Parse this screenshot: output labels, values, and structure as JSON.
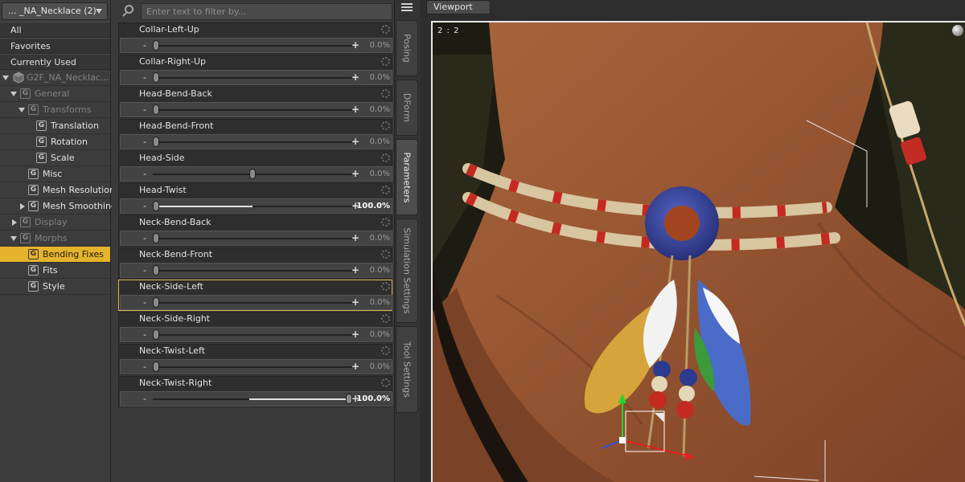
{
  "node_select": {
    "value": "... _NA_Necklace (2)"
  },
  "filters": [
    "All",
    "Favorites",
    "Currently Used"
  ],
  "tree": [
    {
      "label": "G2F_NA_Necklac...",
      "dim": true
    },
    {
      "label": "General",
      "dim": true
    },
    {
      "label": "Transforms",
      "dim": true
    },
    {
      "label": "Translation"
    },
    {
      "label": "Rotation"
    },
    {
      "label": "Scale"
    },
    {
      "label": "Misc"
    },
    {
      "label": "Mesh Resolution"
    },
    {
      "label": "Mesh Smoothing"
    },
    {
      "label": "Display",
      "dim": true
    },
    {
      "label": "Morphs",
      "dim": true
    },
    {
      "label": "Bending Fixes",
      "selected": true
    },
    {
      "label": "Fits"
    },
    {
      "label": "Style"
    }
  ],
  "params_filter": {
    "placeholder": "Enter text to filter by..."
  },
  "parameters": [
    {
      "name": "Collar-Left-Up",
      "value": "0.0%",
      "level": 0.0,
      "bipolar": false
    },
    {
      "name": "Collar-Right-Up",
      "value": "0.0%",
      "level": 0.0,
      "bipolar": false
    },
    {
      "name": "Head-Bend-Back",
      "value": "0.0%",
      "level": 0.0,
      "bipolar": false
    },
    {
      "name": "Head-Bend-Front",
      "value": "0.0%",
      "level": 0.0,
      "bipolar": false
    },
    {
      "name": "Head-Side",
      "value": "0.0%",
      "level": 0.0,
      "bipolar": true
    },
    {
      "name": "Head-Twist",
      "value": "-100.0%",
      "level": -1.0,
      "bipolar": true
    },
    {
      "name": "Neck-Bend-Back",
      "value": "0.0%",
      "level": 0.0,
      "bipolar": false
    },
    {
      "name": "Neck-Bend-Front",
      "value": "0.0%",
      "level": 0.0,
      "bipolar": false
    },
    {
      "name": "Neck-Side-Left",
      "value": "0.0%",
      "level": 0.0,
      "bipolar": false,
      "focused": true
    },
    {
      "name": "Neck-Side-Right",
      "value": "0.0%",
      "level": 0.0,
      "bipolar": false
    },
    {
      "name": "Neck-Twist-Left",
      "value": "0.0%",
      "level": 0.0,
      "bipolar": false
    },
    {
      "name": "Neck-Twist-Right",
      "value": "100.0%",
      "level": 1.0,
      "bipolar": true
    }
  ],
  "side_tabs": [
    {
      "label": "Posing"
    },
    {
      "label": "DForm"
    },
    {
      "label": "Parameters",
      "active": true
    },
    {
      "label": "Simulation Settings"
    },
    {
      "label": "Tool Settings"
    }
  ],
  "viewport": {
    "tab_label": "Viewport",
    "camera_label": "2 : 2"
  },
  "colors": {
    "selection": "#e6b32d",
    "focus_outline": "#d4b64a",
    "skin": "#9c5a33",
    "bead_red": "#c42a22",
    "disc_blue": "#3d4a9e"
  }
}
